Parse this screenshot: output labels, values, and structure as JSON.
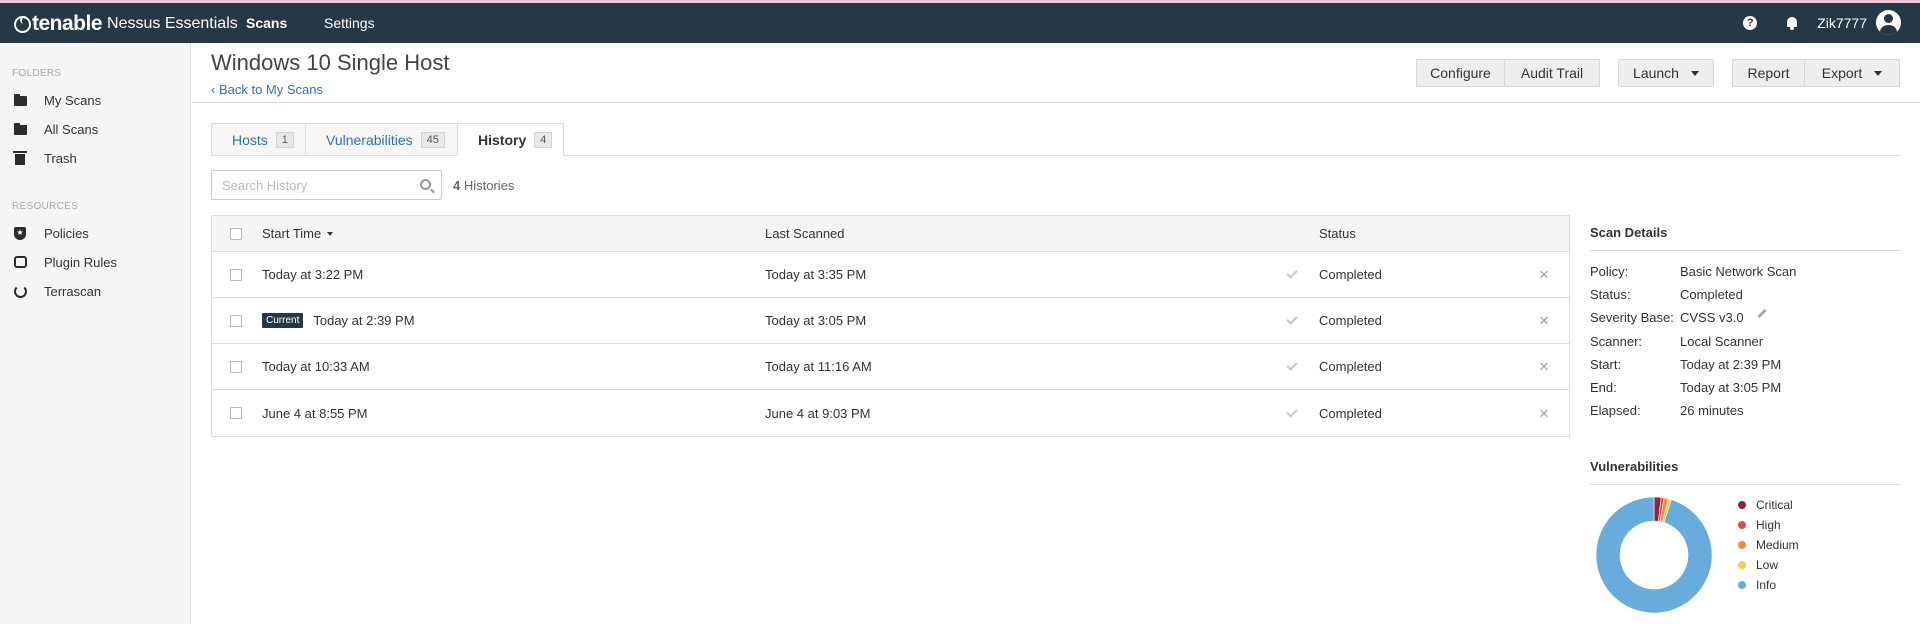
{
  "topbar": {
    "logo_main": "tenable",
    "logo_sub": "Nessus Essentials",
    "nav": [
      {
        "label": "Scans"
      },
      {
        "label": "Settings"
      }
    ],
    "username": "Zik7777"
  },
  "sidebar": {
    "folders_heading": "FOLDERS",
    "folders": [
      {
        "label": "My Scans",
        "icon": "folder-icon"
      },
      {
        "label": "All Scans",
        "icon": "folder-icon"
      },
      {
        "label": "Trash",
        "icon": "trash-icon"
      }
    ],
    "resources_heading": "RESOURCES",
    "resources": [
      {
        "label": "Policies",
        "icon": "shield-icon"
      },
      {
        "label": "Plugin Rules",
        "icon": "plugin-icon"
      },
      {
        "label": "Terrascan",
        "icon": "terrascan-icon"
      }
    ]
  },
  "header": {
    "title": "Windows 10 Single Host",
    "back_link": "Back to My Scans",
    "buttons": {
      "configure": "Configure",
      "audit_trail": "Audit Trail",
      "launch": "Launch",
      "report": "Report",
      "export": "Export"
    }
  },
  "tabs": [
    {
      "label": "Hosts",
      "count": "1"
    },
    {
      "label": "Vulnerabilities",
      "count": "45"
    },
    {
      "label": "History",
      "count": "4"
    }
  ],
  "search": {
    "placeholder": "Search History",
    "count_number": "4",
    "count_label": "Histories"
  },
  "table": {
    "headers": {
      "start_time": "Start Time",
      "last_scanned": "Last Scanned",
      "status": "Status"
    },
    "rows": [
      {
        "start": "Today at 3:22 PM",
        "last": "Today at 3:35 PM",
        "status": "Completed",
        "current": ""
      },
      {
        "start": "Today at 2:39 PM",
        "last": "Today at 3:05 PM",
        "status": "Completed",
        "current": "Current"
      },
      {
        "start": "Today at 10:33 AM",
        "last": "Today at 11:16 AM",
        "status": "Completed",
        "current": ""
      },
      {
        "start": "June 4 at 8:55 PM",
        "last": "June 4 at 9:03 PM",
        "status": "Completed",
        "current": ""
      }
    ]
  },
  "scan_details": {
    "title": "Scan Details",
    "items": [
      {
        "label": "Policy:",
        "value": "Basic Network Scan"
      },
      {
        "label": "Status:",
        "value": "Completed"
      },
      {
        "label": "Severity Base:",
        "value": "CVSS v3.0"
      },
      {
        "label": "Scanner:",
        "value": "Local Scanner"
      },
      {
        "label": "Start:",
        "value": "Today at 2:39 PM"
      },
      {
        "label": "End:",
        "value": "Today at 3:05 PM"
      },
      {
        "label": "Elapsed:",
        "value": "26 minutes"
      }
    ]
  },
  "vulnerabilities": {
    "title": "Vulnerabilities",
    "legend": [
      {
        "label": "Critical",
        "color": "#91243e"
      },
      {
        "label": "High",
        "color": "#dd4b50"
      },
      {
        "label": "Medium",
        "color": "#f18c43"
      },
      {
        "label": "Low",
        "color": "#f8c851"
      },
      {
        "label": "Info",
        "color": "#67acdd"
      }
    ],
    "donut_fractions": [
      0.02,
      0.008,
      0.012,
      0.008,
      0.952
    ]
  }
}
